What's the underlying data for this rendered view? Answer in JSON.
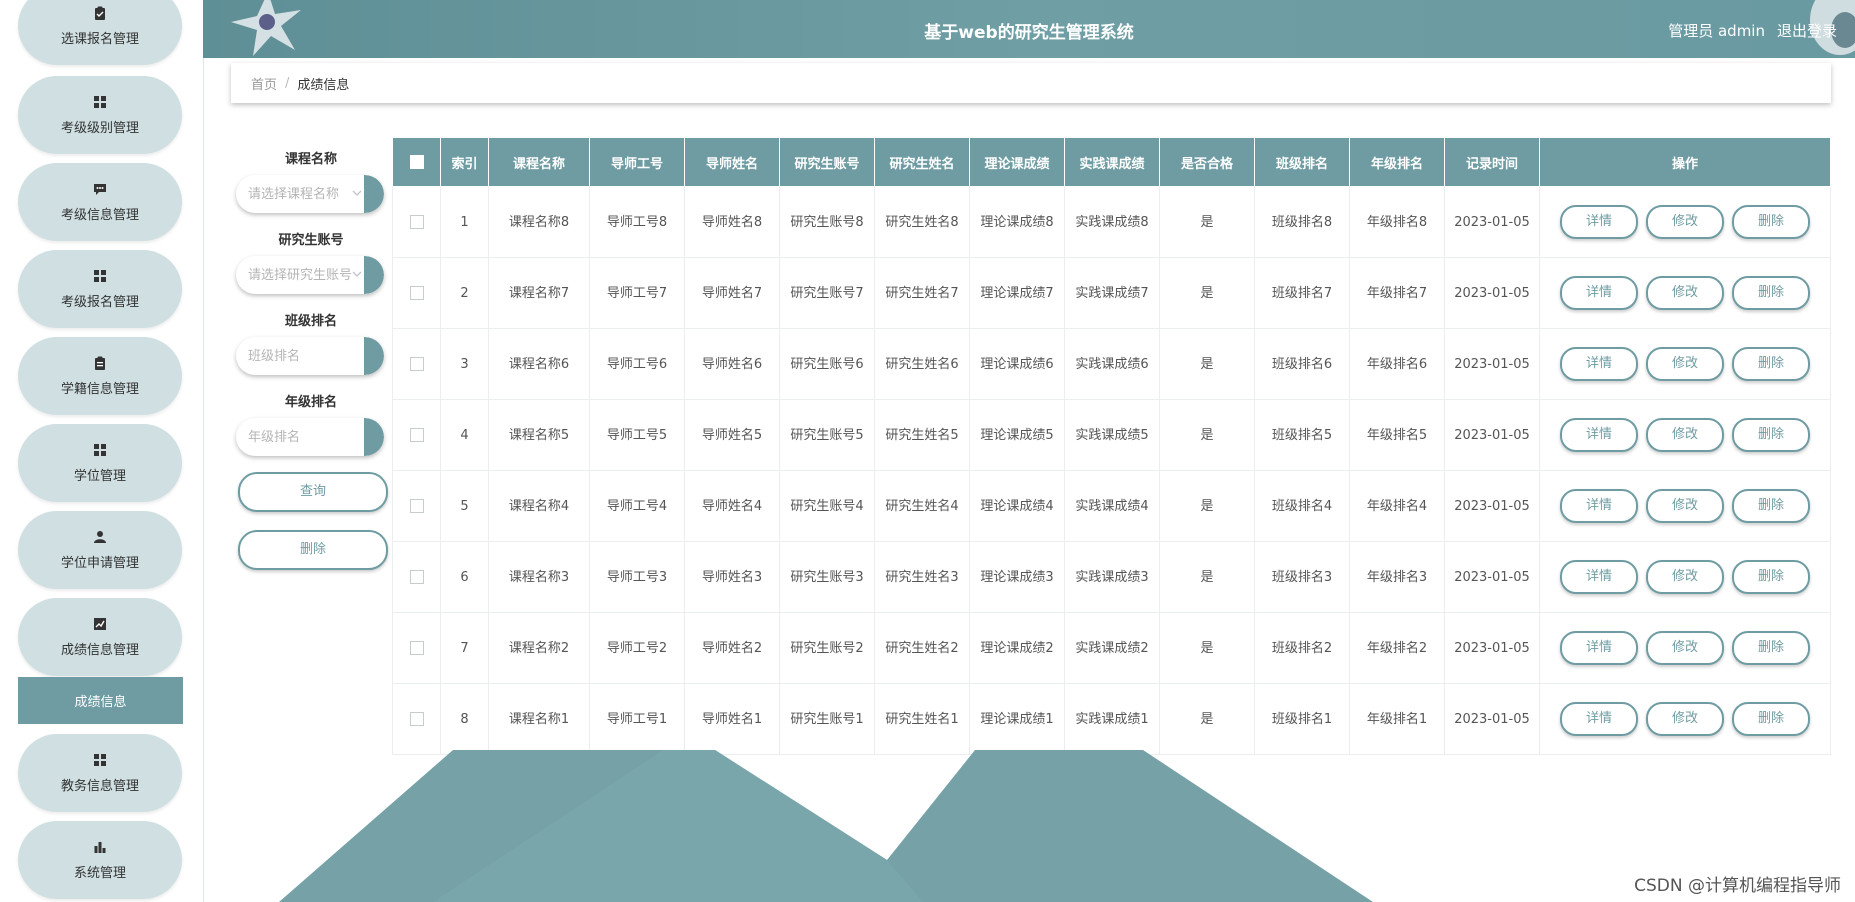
{
  "header": {
    "title": "基于web的研究生管理系统",
    "user": "管理员 admin",
    "logout": "退出登录"
  },
  "sidebar": {
    "items": [
      {
        "label": "选课报名管理",
        "icon": "clipboard-icon"
      },
      {
        "label": "考级级别管理",
        "icon": "grid-icon"
      },
      {
        "label": "考级信息管理",
        "icon": "message-icon"
      },
      {
        "label": "考级报名管理",
        "icon": "grid-icon"
      },
      {
        "label": "学籍信息管理",
        "icon": "clipboard-icon"
      },
      {
        "label": "学位管理",
        "icon": "grid-icon"
      },
      {
        "label": "学位申请管理",
        "icon": "user-icon"
      },
      {
        "label": "成绩信息管理",
        "icon": "chart-icon"
      },
      {
        "label": "教务信息管理",
        "icon": "grid-icon"
      },
      {
        "label": "系统管理",
        "icon": "bar-chart-icon"
      }
    ],
    "active_sub": "成绩信息"
  },
  "breadcrumb": {
    "home": "首页",
    "sep": "/",
    "current": "成绩信息"
  },
  "search": {
    "course_label": "课程名称",
    "course_placeholder": "请选择课程名称",
    "student_label": "研究生账号",
    "student_placeholder": "请选择研究生账号",
    "class_rank_label": "班级排名",
    "class_rank_placeholder": "班级排名",
    "grade_rank_label": "年级排名",
    "grade_rank_placeholder": "年级排名",
    "query_button": "查询",
    "delete_button": "删除"
  },
  "table": {
    "headers": [
      "索引",
      "课程名称",
      "导师工号",
      "导师姓名",
      "研究生账号",
      "研究生姓名",
      "理论课成绩",
      "实践课成绩",
      "是否合格",
      "班级排名",
      "年级排名",
      "记录时间",
      "操作"
    ],
    "actions": {
      "detail": "详情",
      "edit": "修改",
      "delete": "删除"
    },
    "rows": [
      {
        "index": "1",
        "course": "课程名称8",
        "tutor_id": "导师工号8",
        "tutor_name": "导师姓名8",
        "student_id": "研究生账号8",
        "student_name": "研究生姓名8",
        "theory": "理论课成绩8",
        "practice": "实践课成绩8",
        "passed": "是",
        "class_rank": "班级排名8",
        "grade_rank": "年级排名8",
        "time": "2023-01-05"
      },
      {
        "index": "2",
        "course": "课程名称7",
        "tutor_id": "导师工号7",
        "tutor_name": "导师姓名7",
        "student_id": "研究生账号7",
        "student_name": "研究生姓名7",
        "theory": "理论课成绩7",
        "practice": "实践课成绩7",
        "passed": "是",
        "class_rank": "班级排名7",
        "grade_rank": "年级排名7",
        "time": "2023-01-05"
      },
      {
        "index": "3",
        "course": "课程名称6",
        "tutor_id": "导师工号6",
        "tutor_name": "导师姓名6",
        "student_id": "研究生账号6",
        "student_name": "研究生姓名6",
        "theory": "理论课成绩6",
        "practice": "实践课成绩6",
        "passed": "是",
        "class_rank": "班级排名6",
        "grade_rank": "年级排名6",
        "time": "2023-01-05"
      },
      {
        "index": "4",
        "course": "课程名称5",
        "tutor_id": "导师工号5",
        "tutor_name": "导师姓名5",
        "student_id": "研究生账号5",
        "student_name": "研究生姓名5",
        "theory": "理论课成绩5",
        "practice": "实践课成绩5",
        "passed": "是",
        "class_rank": "班级排名5",
        "grade_rank": "年级排名5",
        "time": "2023-01-05"
      },
      {
        "index": "5",
        "course": "课程名称4",
        "tutor_id": "导师工号4",
        "tutor_name": "导师姓名4",
        "student_id": "研究生账号4",
        "student_name": "研究生姓名4",
        "theory": "理论课成绩4",
        "practice": "实践课成绩4",
        "passed": "是",
        "class_rank": "班级排名4",
        "grade_rank": "年级排名4",
        "time": "2023-01-05"
      },
      {
        "index": "6",
        "course": "课程名称3",
        "tutor_id": "导师工号3",
        "tutor_name": "导师姓名3",
        "student_id": "研究生账号3",
        "student_name": "研究生姓名3",
        "theory": "理论课成绩3",
        "practice": "实践课成绩3",
        "passed": "是",
        "class_rank": "班级排名3",
        "grade_rank": "年级排名3",
        "time": "2023-01-05"
      },
      {
        "index": "7",
        "course": "课程名称2",
        "tutor_id": "导师工号2",
        "tutor_name": "导师姓名2",
        "student_id": "研究生账号2",
        "student_name": "研究生姓名2",
        "theory": "理论课成绩2",
        "practice": "实践课成绩2",
        "passed": "是",
        "class_rank": "班级排名2",
        "grade_rank": "年级排名2",
        "time": "2023-01-05"
      },
      {
        "index": "8",
        "course": "课程名称1",
        "tutor_id": "导师工号1",
        "tutor_name": "导师姓名1",
        "student_id": "研究生账号1",
        "student_name": "研究生姓名1",
        "theory": "理论课成绩1",
        "practice": "实践课成绩1",
        "passed": "是",
        "class_rank": "班级排名1",
        "grade_rank": "年级排名1",
        "time": "2023-01-05"
      }
    ]
  },
  "watermark": "CSDN @计算机编程指导师",
  "colors": {
    "accent": "#6e9ca2",
    "sidebar_item": "#cfdfe2",
    "header": "#6a9aa1"
  }
}
